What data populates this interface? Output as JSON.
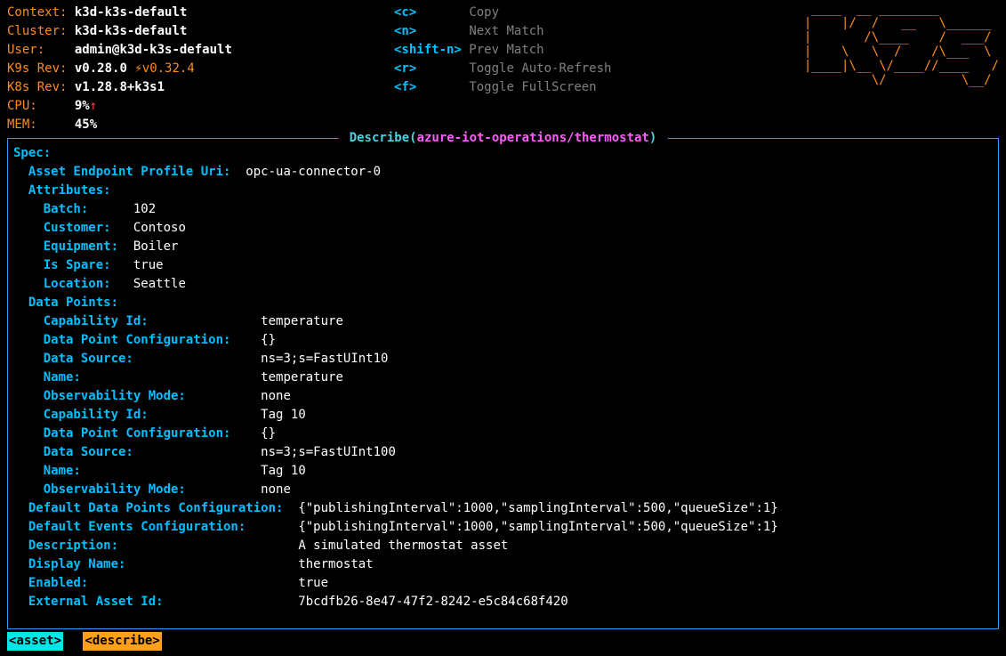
{
  "header": {
    "left": {
      "context_label": "Context:",
      "context": "k3d-k3s-default",
      "cluster_label": "Cluster:",
      "cluster": "k3d-k3s-default",
      "user_label": "User:",
      "user": "admin@k3d-k3s-default",
      "k9srev_label": "K9s Rev:",
      "k9srev": "v0.28.0",
      "k9srev_update_arrow": "⚡",
      "k9srev_update": "v0.32.4",
      "k8srev_label": "K8s Rev:",
      "k8srev": "v1.28.8+k3s1",
      "cpu_label": "CPU:",
      "cpu": "9%",
      "cpu_arrow": "↑",
      "mem_label": "MEM:",
      "mem": "45%"
    },
    "keys": [
      {
        "key": "<c>",
        "action": "Copy"
      },
      {
        "key": "<n>",
        "action": "Next Match"
      },
      {
        "key": "<shift-n>",
        "action": "Prev Match"
      },
      {
        "key": "<r>",
        "action": "Toggle Auto-Refresh"
      },
      {
        "key": "<f>",
        "action": "Toggle FullScreen"
      }
    ],
    "logo": " ____  __ ________        \n|    |/  /   __   \\______ \n|       /\\____    /  ___/ \n|    \\   \\  /    /\\___  \\ \n|____|\\__ \\/____//____   /\n         \\/          \\__/ "
  },
  "panel": {
    "title_prefix": " Describe",
    "title_open": "(",
    "title_ns": "azure-iot-operations/thermostat",
    "title_close": ") "
  },
  "spec": {
    "heading": "Spec:",
    "asset_ep_label": "Asset Endpoint Profile Uri:",
    "asset_ep": "opc-ua-connector-0",
    "attributes_label": "Attributes:",
    "attrs": {
      "batch_label": "Batch:",
      "batch": "102",
      "customer_label": "Customer:",
      "customer": "Contoso",
      "equipment_label": "Equipment:",
      "equipment": "Boiler",
      "isspare_label": "Is Spare:",
      "isspare": "true",
      "location_label": "Location:",
      "location": "Seattle"
    },
    "datapoints_label": "Data Points:",
    "dp1": {
      "capid_label": "Capability Id:",
      "capid": "temperature",
      "dpc_label": "Data Point Configuration:",
      "dpc": "{}",
      "ds_label": "Data Source:",
      "ds": "ns=3;s=FastUInt10",
      "name_label": "Name:",
      "name": "temperature",
      "obs_label": "Observability Mode:",
      "obs": "none"
    },
    "dp2": {
      "capid_label": "Capability Id:",
      "capid": "Tag 10",
      "dpc_label": "Data Point Configuration:",
      "dpc": "{}",
      "ds_label": "Data Source:",
      "ds": "ns=3;s=FastUInt100",
      "name_label": "Name:",
      "name": "Tag 10",
      "obs_label": "Observability Mode:",
      "obs": "none"
    },
    "defdpc_label": "Default Data Points Configuration:",
    "defdpc": "{\"publishingInterval\":1000,\"samplingInterval\":500,\"queueSize\":1}",
    "defevc_label": "Default Events Configuration:",
    "defevc": "{\"publishingInterval\":1000,\"samplingInterval\":500,\"queueSize\":1}",
    "desc_label": "Description:",
    "desc": "A simulated thermostat asset",
    "disp_label": "Display Name:",
    "disp": "thermostat",
    "enabled_label": "Enabled:",
    "enabled": "true",
    "extid_label": "External Asset Id:",
    "extid": "7bcdfb26-8e47-47f2-8242-e5c84c68f420"
  },
  "footer": {
    "crumb1": "<asset>",
    "crumb2": "<describe>"
  }
}
